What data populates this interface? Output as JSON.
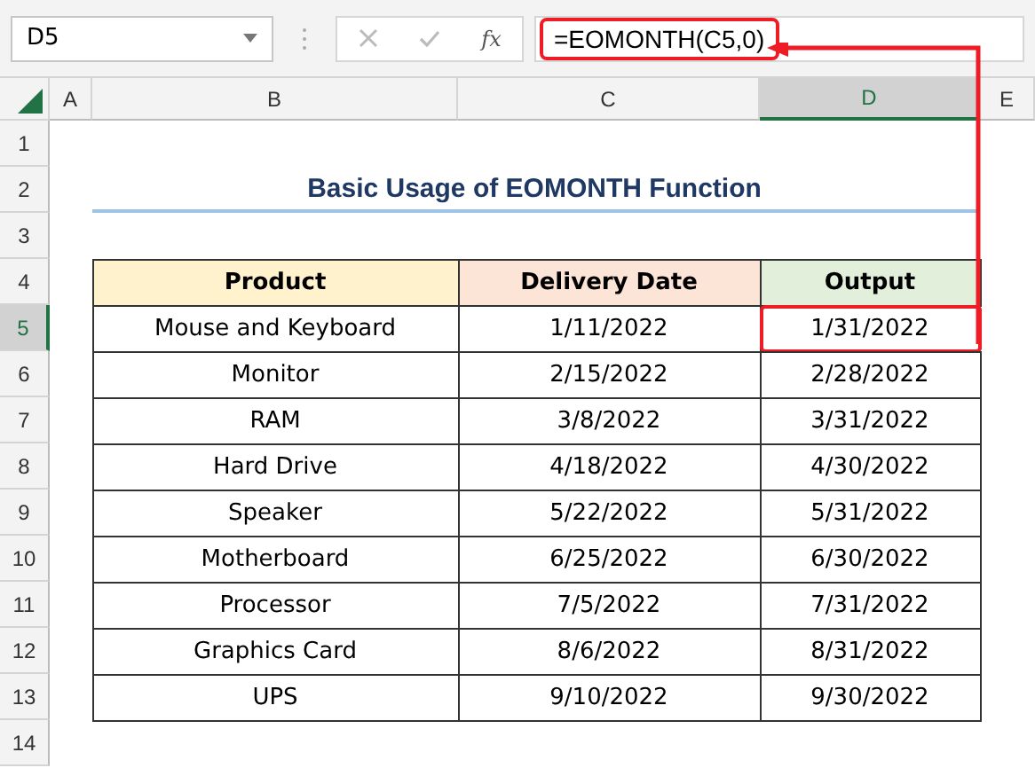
{
  "name_box": "D5",
  "formula_bar": {
    "function_label": "fx",
    "formula": "=EOMONTH(C5,0)",
    "highlighted": true
  },
  "column_headers": [
    {
      "label": "A",
      "selected": false
    },
    {
      "label": "B",
      "selected": false
    },
    {
      "label": "C",
      "selected": false
    },
    {
      "label": "D",
      "selected": true
    },
    {
      "label": "E",
      "selected": false
    }
  ],
  "row_headers": [
    {
      "label": "1",
      "selected": false
    },
    {
      "label": "2",
      "selected": false
    },
    {
      "label": "3",
      "selected": false
    },
    {
      "label": "4",
      "selected": false
    },
    {
      "label": "5",
      "selected": true
    },
    {
      "label": "6",
      "selected": false
    },
    {
      "label": "7",
      "selected": false
    },
    {
      "label": "8",
      "selected": false
    },
    {
      "label": "9",
      "selected": false
    },
    {
      "label": "10",
      "selected": false
    },
    {
      "label": "11",
      "selected": false
    },
    {
      "label": "12",
      "selected": false
    },
    {
      "label": "13",
      "selected": false
    },
    {
      "label": "14",
      "selected": false
    }
  ],
  "title": "Basic Usage of EOMONTH Function",
  "table": {
    "columns": [
      {
        "label": "Product",
        "color": "#fff2cc"
      },
      {
        "label": "Delivery Date",
        "color": "#fce4d6"
      },
      {
        "label": "Output",
        "color": "#e2efda"
      }
    ],
    "rows": [
      {
        "cells": [
          {
            "text": "Mouse and Keyboard",
            "highlighted": false
          },
          {
            "text": "1/11/2022",
            "highlighted": false
          },
          {
            "text": "1/31/2022",
            "highlighted": true
          }
        ]
      },
      {
        "cells": [
          {
            "text": "Monitor",
            "highlighted": false
          },
          {
            "text": "2/15/2022",
            "highlighted": false
          },
          {
            "text": "2/28/2022",
            "highlighted": false
          }
        ]
      },
      {
        "cells": [
          {
            "text": "RAM",
            "highlighted": false
          },
          {
            "text": "3/8/2022",
            "highlighted": false
          },
          {
            "text": "3/31/2022",
            "highlighted": false
          }
        ]
      },
      {
        "cells": [
          {
            "text": "Hard Drive",
            "highlighted": false
          },
          {
            "text": "4/18/2022",
            "highlighted": false
          },
          {
            "text": "4/30/2022",
            "highlighted": false
          }
        ]
      },
      {
        "cells": [
          {
            "text": "Speaker",
            "highlighted": false
          },
          {
            "text": "5/22/2022",
            "highlighted": false
          },
          {
            "text": "5/31/2022",
            "highlighted": false
          }
        ]
      },
      {
        "cells": [
          {
            "text": "Motherboard",
            "highlighted": false
          },
          {
            "text": "6/25/2022",
            "highlighted": false
          },
          {
            "text": "6/30/2022",
            "highlighted": false
          }
        ]
      },
      {
        "cells": [
          {
            "text": "Processor",
            "highlighted": false
          },
          {
            "text": "7/5/2022",
            "highlighted": false
          },
          {
            "text": "7/31/2022",
            "highlighted": false
          }
        ]
      },
      {
        "cells": [
          {
            "text": "Graphics Card",
            "highlighted": false
          },
          {
            "text": "8/6/2022",
            "highlighted": false
          },
          {
            "text": "8/31/2022",
            "highlighted": false
          }
        ]
      },
      {
        "cells": [
          {
            "text": "UPS",
            "highlighted": false
          },
          {
            "text": "9/10/2022",
            "highlighted": false
          },
          {
            "text": "9/30/2022",
            "highlighted": false
          }
        ]
      }
    ]
  }
}
